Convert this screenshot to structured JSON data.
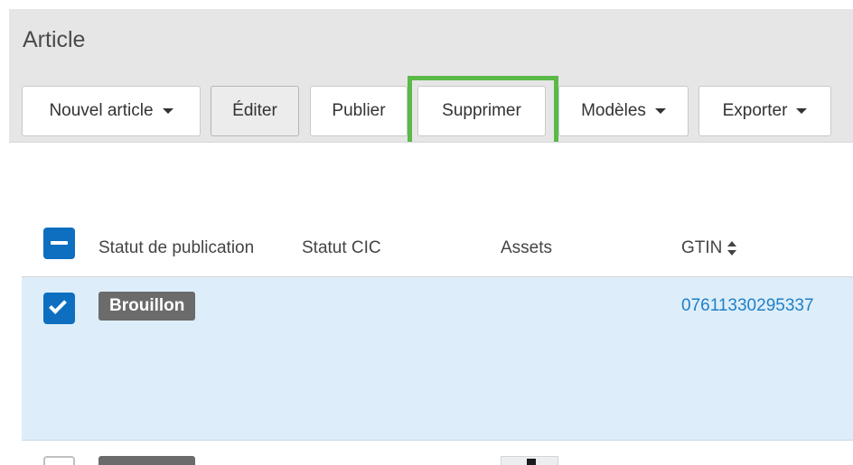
{
  "header": {
    "title": "Article"
  },
  "toolbar": {
    "new_article": "Nouvel article",
    "edit": "Éditer",
    "publish": "Publier",
    "delete": "Supprimer",
    "templates": "Modèles",
    "export": "Exporter"
  },
  "table": {
    "columns": {
      "status": "Statut de publication",
      "cic": "Statut CIC",
      "assets": "Assets",
      "gtin": "GTIN"
    },
    "rows": [
      {
        "status": "Brouillon",
        "gtin": "07611330295337",
        "selected": true
      }
    ]
  },
  "colors": {
    "accent": "#0e6fc1",
    "highlight": "#5ab947",
    "selected_row": "#ddeefa",
    "badge": "#6b6b6b",
    "link": "#1f7fc7"
  }
}
